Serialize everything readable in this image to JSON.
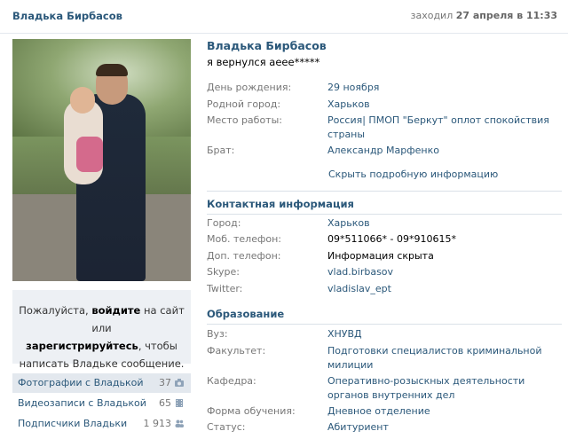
{
  "topbar": {
    "name": "Владька Бирбасов",
    "last_seen_prefix": "заходил",
    "last_seen_time": "27 апреля в 11:33"
  },
  "profile": {
    "name": "Владька Бирбасов",
    "status": "я вернулся аеее*****",
    "basic": [
      {
        "label": "День рождения:",
        "value": "29 ноября"
      },
      {
        "label": "Родной город:",
        "value": "Харьков"
      },
      {
        "label": "Место работы:",
        "value": "Россия| ПМОП \"Беркут\" оплот спокойствия страны"
      },
      {
        "label": "Брат:",
        "value": "Александр Марфенко"
      }
    ],
    "toggle_details": "Скрыть подробную информацию",
    "contact_title": "Контактная информация",
    "contact": [
      {
        "label": "Город:",
        "value": "Харьков"
      },
      {
        "label": "Моб. телефон:",
        "value": "09*511066* - 09*910615*"
      },
      {
        "label": "Доп. телефон:",
        "value": "Информация скрыта"
      },
      {
        "label": "Skype:",
        "value": "vlad.birbasov"
      },
      {
        "label": "Twitter:",
        "value": "vladislav_ept"
      }
    ],
    "education_title": "Образование",
    "education": [
      {
        "label": "Вуз:",
        "value": "ХНУВД"
      },
      {
        "label": "Факультет:",
        "value": "Подготовки специалистов криминальной милиции"
      },
      {
        "label": "Кафедра:",
        "value": "Оперативно-розыскных деятельности органов внутренних дел"
      },
      {
        "label": "Форма обучения:",
        "value": "Дневное отделение"
      },
      {
        "label": "Статус:",
        "value": "Абитуриент"
      }
    ]
  },
  "message_box": {
    "line1_pre": "Пожалуйста,",
    "login": "войдите",
    "line1_post": "на сайт или",
    "register": "зарегистрируйтесь",
    "line2_post": ", чтобы",
    "line3": "написать Владьке сообщение."
  },
  "links": [
    {
      "label": "Фотографии с Владькой",
      "count": "37",
      "icon": "camera-icon"
    },
    {
      "label": "Видеозаписи с Владькой",
      "count": "65",
      "icon": "film-icon"
    },
    {
      "label": "Подписчики Владьки",
      "count": "1 913",
      "icon": "people-icon"
    }
  ]
}
